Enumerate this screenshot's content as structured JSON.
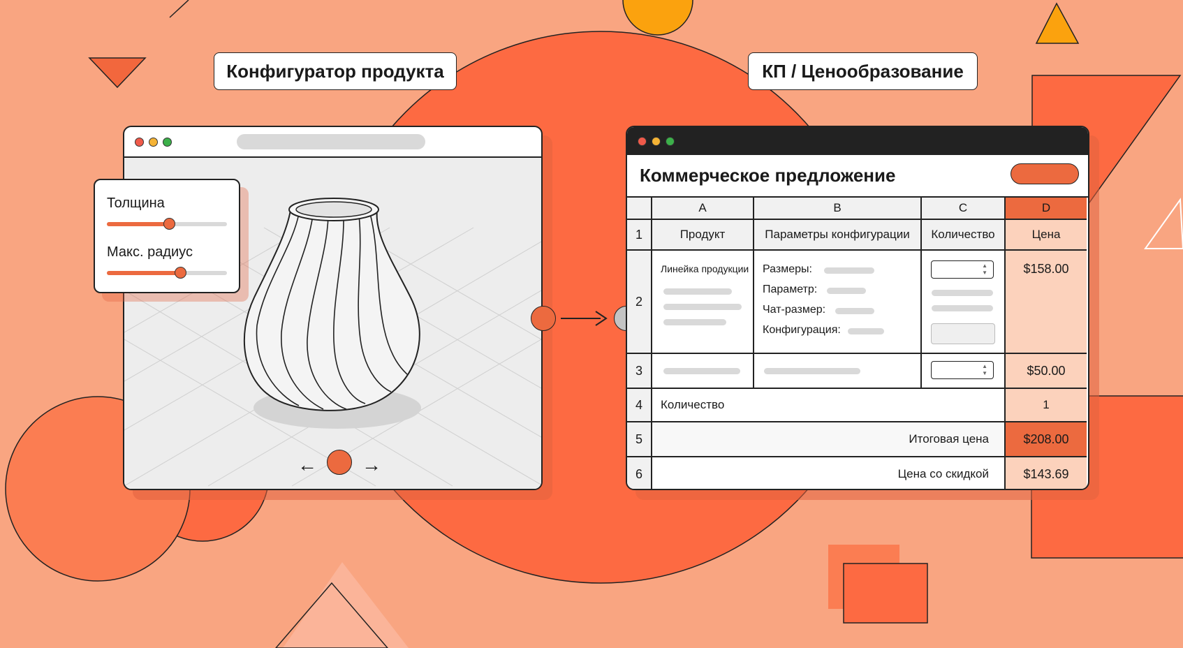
{
  "labels": {
    "configurator": "Конфигуратор продукта",
    "pricing": "КП / Ценообразование"
  },
  "configurator": {
    "sliders": [
      {
        "label": "Толщина",
        "value": 0.52
      },
      {
        "label": "Макс. радиус",
        "value": 0.61
      }
    ],
    "nav": {
      "prev_icon": "arrow-left-icon",
      "next_icon": "arrow-right-icon"
    }
  },
  "quote": {
    "title": "Коммерческое предложение",
    "columns": [
      "A",
      "B",
      "C",
      "D"
    ],
    "row_numbers": [
      "1",
      "2",
      "3",
      "4",
      "5",
      "6"
    ],
    "headers": {
      "product": "Продукт",
      "params": "Параметры конфигурации",
      "qty": "Количество",
      "price": "Цена"
    },
    "row2": {
      "product": "Линейка продукции",
      "params": [
        "Размеры:",
        "Параметр:",
        "Чат-размер:",
        "Конфигурация:"
      ],
      "price": "$158.00"
    },
    "row3": {
      "price": "$50.00"
    },
    "row4": {
      "label": "Количество",
      "value": "1"
    },
    "row5": {
      "label": "Итоговая цена",
      "value": "$208.00"
    },
    "row6": {
      "label": "Цена со скидкой",
      "value": "$143.69"
    }
  },
  "colors": {
    "accent": "#ec6a3f",
    "background": "#f9a581",
    "shape": "#f46a40",
    "highlight_column": "#fcd2bc"
  }
}
